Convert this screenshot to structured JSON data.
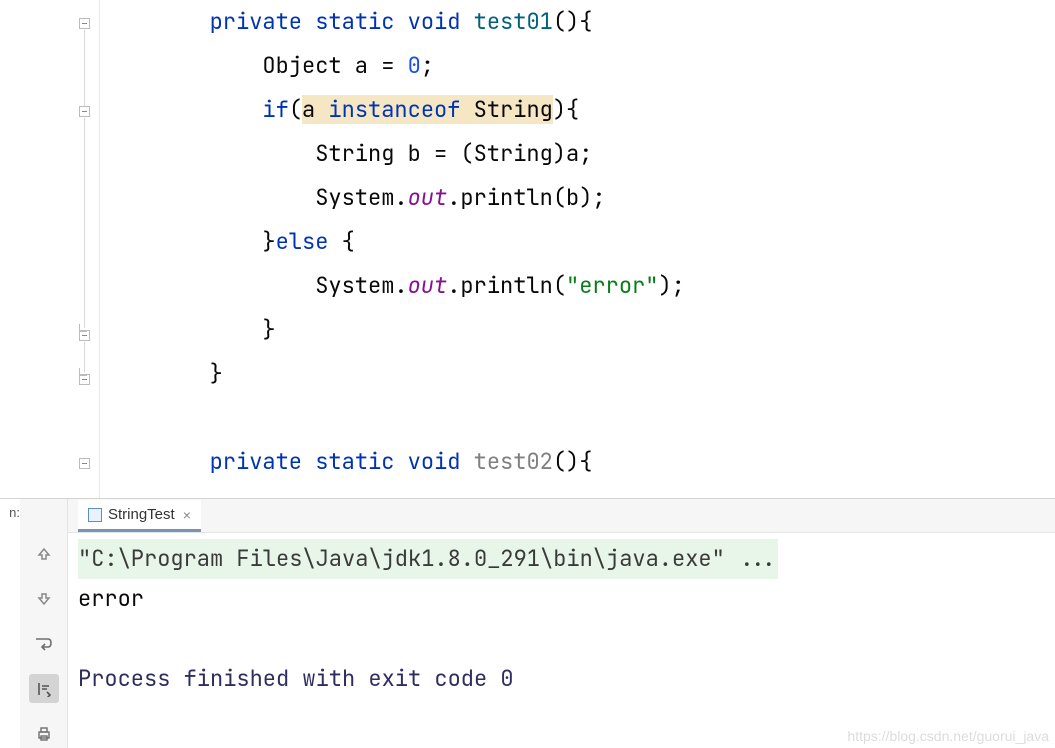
{
  "code": {
    "l1": {
      "indent": "        ",
      "kw1": "private",
      "sp1": " ",
      "kw2": "static",
      "sp2": " ",
      "kw3": "void",
      "sp3": " ",
      "method": "test01",
      "rest": "(){"
    },
    "l2": {
      "indent": "            ",
      "txt1": "Object a = ",
      "num": "0",
      "txt2": ";"
    },
    "l3": {
      "indent": "            ",
      "kw1": "if",
      "txt1": "(",
      "hl1": "a ",
      "hl_kw": "instanceof",
      "hl2": " String",
      "txt2": "){"
    },
    "l4": {
      "indent": "                ",
      "txt": "String b = (String)a;"
    },
    "l5": {
      "indent": "                ",
      "txt1": "System.",
      "field": "out",
      "txt2": ".println(b);"
    },
    "l6": {
      "indent": "            ",
      "txt1": "}",
      "kw": "else",
      "txt2": " {"
    },
    "l7": {
      "indent": "                ",
      "txt1": "System.",
      "field": "out",
      "txt2": ".println(",
      "str": "\"error\"",
      "txt3": ");"
    },
    "l8": {
      "indent": "            ",
      "txt": "}"
    },
    "l9": {
      "indent": "        ",
      "txt": "}"
    },
    "l10": {
      "indent": "        "
    },
    "l11": {
      "indent": "        ",
      "kw1": "private",
      "sp1": " ",
      "kw2": "static",
      "sp2": " ",
      "kw3": "void",
      "sp3": " ",
      "method": "test02",
      "rest": "(){"
    }
  },
  "run_label": "n:",
  "tab": {
    "name": "StringTest",
    "close": "×"
  },
  "console": {
    "cmd": "\"C:\\Program Files\\Java\\jdk1.8.0_291\\bin\\java.exe\" ...",
    "out1": "error",
    "exit": "Process finished with exit code 0"
  },
  "watermark": "https://blog.csdn.net/guorui_java"
}
